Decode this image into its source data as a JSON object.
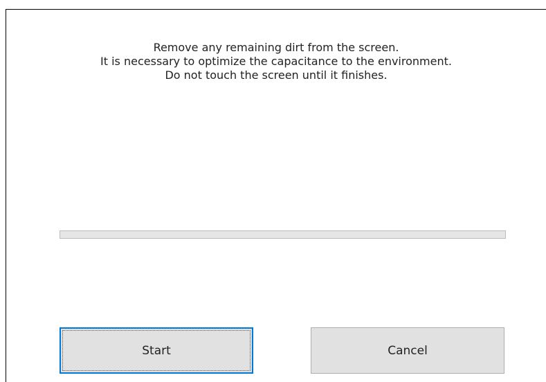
{
  "dialog": {
    "message_lines": [
      "Remove any remaining dirt from the screen.",
      "It is necessary to optimize the capacitance to the environment.",
      "Do not touch the screen until it finishes."
    ],
    "progress": {
      "value": 0,
      "max": 100
    },
    "buttons": {
      "start_label": "Start",
      "cancel_label": "Cancel"
    }
  },
  "colors": {
    "accent_focus": "#0078d7",
    "button_face": "#e1e1e1",
    "progress_fill": "#06b025"
  }
}
